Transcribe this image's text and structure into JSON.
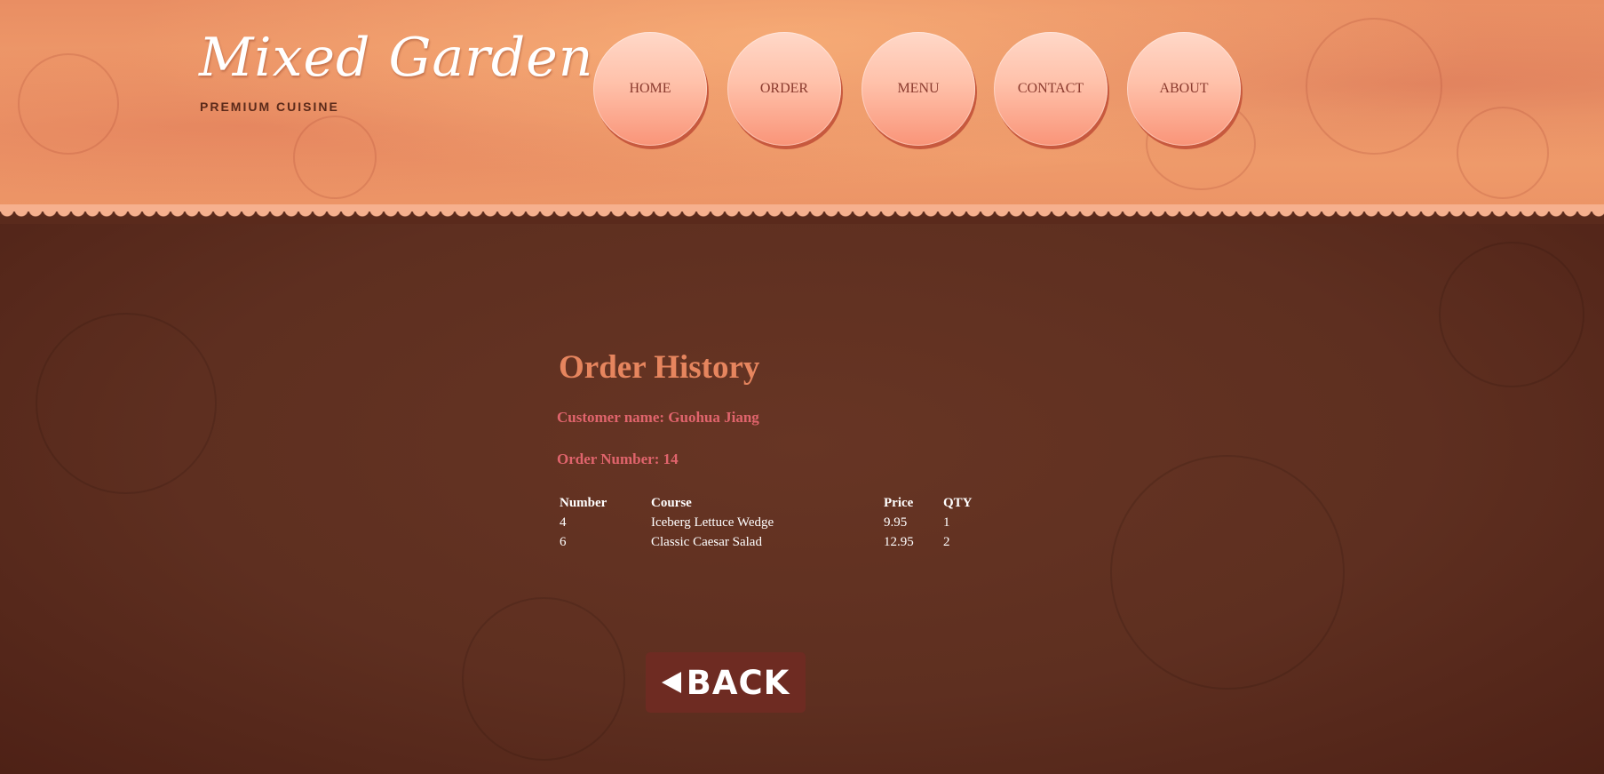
{
  "site": {
    "logo": "Mixed Garden",
    "tagline": "PREMIUM CUISINE"
  },
  "nav": {
    "items": [
      {
        "label": "HOME"
      },
      {
        "label": "ORDER"
      },
      {
        "label": "MENU"
      },
      {
        "label": "CONTACT"
      },
      {
        "label": "ABOUT"
      }
    ]
  },
  "main": {
    "title": "Order History",
    "customer": "Customer name: Guohua Jiang",
    "order_number": "Order Number: 14",
    "table": {
      "headers": [
        "Number",
        "Course",
        "Price",
        "QTY"
      ],
      "rows": [
        [
          "4",
          "Iceberg Lettuce Wedge",
          "9.95",
          "1"
        ],
        [
          "6",
          "Classic Caesar Salad",
          "12.95",
          "2"
        ]
      ]
    },
    "back_label": "BACK"
  },
  "colors": {
    "header_bg": "#f1a06e",
    "main_bg": "#5e2f20",
    "title": "#e6855e",
    "info": "#e0646c",
    "back_button": "#6e2b22"
  }
}
